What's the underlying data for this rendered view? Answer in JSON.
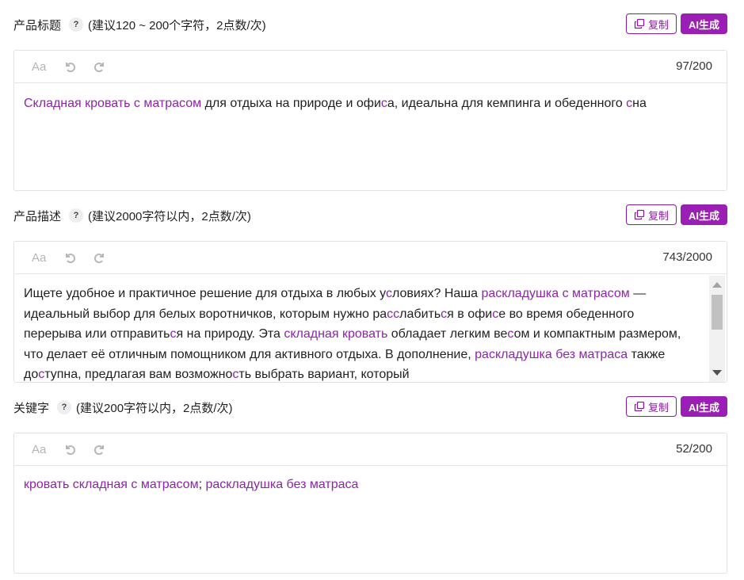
{
  "colors": {
    "accent": "#9b1fb5",
    "keyword": "#8e24aa",
    "border": "#e2e2e2"
  },
  "icons": {
    "copy": "copy-icon",
    "undo": "undo-icon",
    "redo": "redo-icon",
    "help": "help-icon"
  },
  "buttons": {
    "copy_label": "复制",
    "ai_label": "AI生成",
    "font_label": "Aa",
    "help_label": "?"
  },
  "title_section": {
    "label": "产品标题",
    "hint": "(建议120 ~ 200个字符，2点数/次)",
    "counter": "97/200",
    "segments": [
      {
        "text": "Складная кровать с матрасом",
        "kw": true
      },
      {
        "text": " для отдыха на природе и офи",
        "kw": false
      },
      {
        "text": "с",
        "kw": true
      },
      {
        "text": "а, идеальна для кемпинга и обеденного ",
        "kw": false
      },
      {
        "text": "с",
        "kw": true
      },
      {
        "text": "на",
        "kw": false
      }
    ]
  },
  "desc_section": {
    "label": "产品描述",
    "hint": "(建议2000字符以内，2点数/次)",
    "counter": "743/2000",
    "segments": [
      {
        "text": "Ищете удобное и практичное решение для отдыха в любых у",
        "kw": false
      },
      {
        "text": "с",
        "kw": true
      },
      {
        "text": "ловиях? Наша ",
        "kw": false
      },
      {
        "text": "раскладушка с матрасом",
        "kw": true
      },
      {
        "text": " — идеальный выбор для белых воротничков, которым нужно ра",
        "kw": false
      },
      {
        "text": "сс",
        "kw": true
      },
      {
        "text": "лабить",
        "kw": false
      },
      {
        "text": "с",
        "kw": true
      },
      {
        "text": "я в офи",
        "kw": false
      },
      {
        "text": "с",
        "kw": true
      },
      {
        "text": "е во время обеденного перерыва или отправить",
        "kw": false
      },
      {
        "text": "с",
        "kw": true
      },
      {
        "text": "я на природу. Эта ",
        "kw": false
      },
      {
        "text": "складная кровать",
        "kw": true
      },
      {
        "text": " обладает легким ве",
        "kw": false
      },
      {
        "text": "с",
        "kw": true
      },
      {
        "text": "ом и компактным размером, что делает её отличным помощником для активного отдыха. В дополнение, ",
        "kw": false
      },
      {
        "text": "раскладушка без матраса",
        "kw": true
      },
      {
        "text": " также до",
        "kw": false
      },
      {
        "text": "с",
        "kw": true
      },
      {
        "text": "тупна, предлагая вам возможно",
        "kw": false
      },
      {
        "text": "с",
        "kw": true
      },
      {
        "text": "ть выбрать вариант, который",
        "kw": false
      }
    ]
  },
  "keyword_section": {
    "label": "关键字",
    "hint": "(建议200字符以内，2点数/次)",
    "counter": "52/200",
    "segments": [
      {
        "text": "кровать складная с матрасом",
        "kw": true
      },
      {
        "text": "; ",
        "kw": false
      },
      {
        "text": "раскладушка без матраса",
        "kw": true
      }
    ]
  }
}
